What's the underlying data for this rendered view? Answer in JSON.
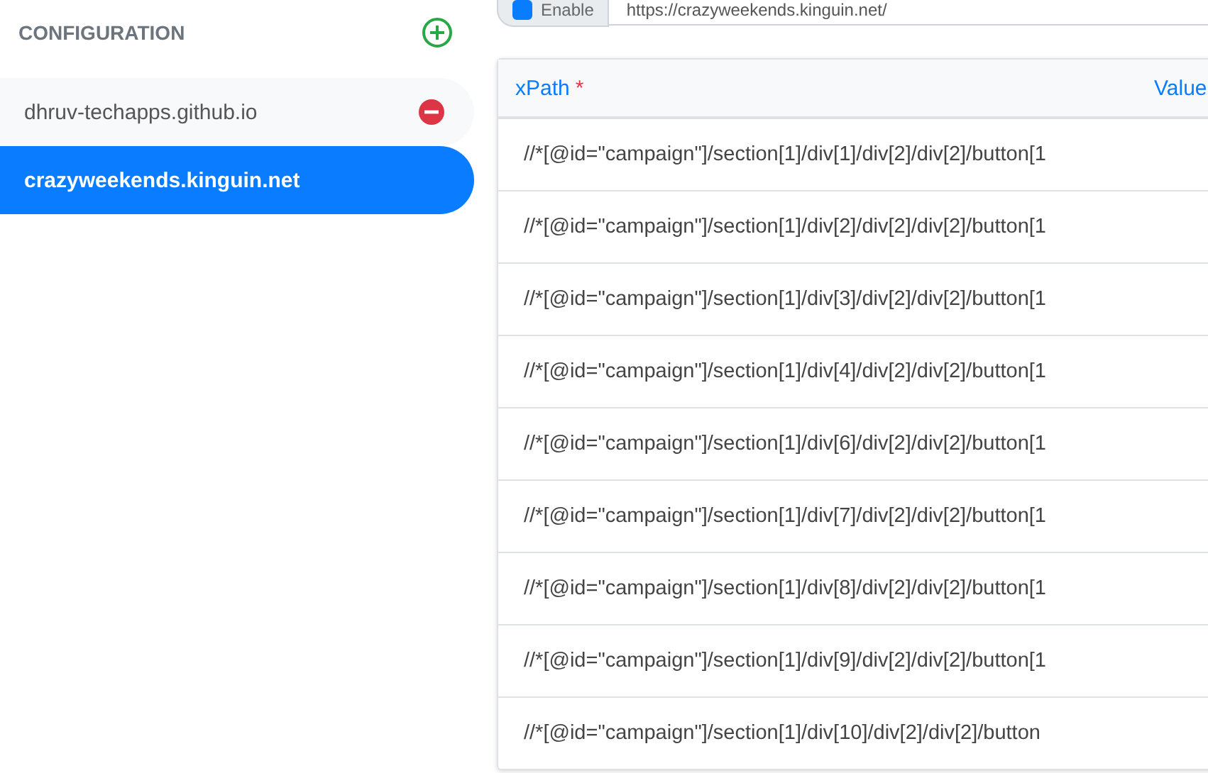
{
  "sidebar": {
    "title": "CONFIGURATION",
    "items": [
      {
        "label": "dhruv-techapps.github.io",
        "selected": false,
        "removable": true
      },
      {
        "label": "crazyweekends.kinguin.net",
        "selected": true,
        "removable": false
      }
    ]
  },
  "top_bar": {
    "enable": {
      "label": "Enable",
      "checked": true
    },
    "url": "https://crazyweekends.kinguin.net/"
  },
  "table": {
    "columns": [
      {
        "label": "xPath",
        "required_mark": "*"
      },
      {
        "label": "Value"
      }
    ],
    "rows": [
      "//*[@id=\"campaign\"]/section[1]/div[1]/div[2]/div[2]/button[1",
      "//*[@id=\"campaign\"]/section[1]/div[2]/div[2]/div[2]/button[1",
      "//*[@id=\"campaign\"]/section[1]/div[3]/div[2]/div[2]/button[1",
      "//*[@id=\"campaign\"]/section[1]/div[4]/div[2]/div[2]/button[1",
      "//*[@id=\"campaign\"]/section[1]/div[6]/div[2]/div[2]/button[1",
      "//*[@id=\"campaign\"]/section[1]/div[7]/div[2]/div[2]/button[1",
      "//*[@id=\"campaign\"]/section[1]/div[8]/div[2]/div[2]/button[1",
      "//*[@id=\"campaign\"]/section[1]/div[9]/div[2]/div[2]/button[1",
      "//*[@id=\"campaign\"]/section[1]/div[10]/div[2]/div[2]/button"
    ]
  }
}
